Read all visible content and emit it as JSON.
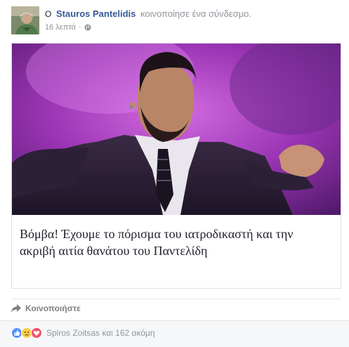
{
  "header": {
    "prefix": "Ο",
    "author": "Stauros Pantelidis",
    "action": "κοινοποίησε ένα σύνδεσμο.",
    "time": "16 λεπτά",
    "separator": "·"
  },
  "link": {
    "title": "Βόμβα! Έχουμε το πόρισμα του ιατροδικαστή και την ακριβή αιτία θανάτου του Παντελίδη"
  },
  "actions": {
    "share_label": "Κοινοποιήστε"
  },
  "reactions": {
    "icons": [
      "like-icon",
      "sad-icon",
      "love-icon"
    ],
    "summary_name": "Spiros Zoitsas",
    "summary_rest": "και 162 ακόμη"
  },
  "colors": {
    "author_link": "#365899",
    "meta_grey": "#90949c",
    "image_purple": "#9a34b4",
    "like_blue": "#5890ff",
    "love_red": "#f25268",
    "sad_yellow": "#f7cb4d"
  }
}
